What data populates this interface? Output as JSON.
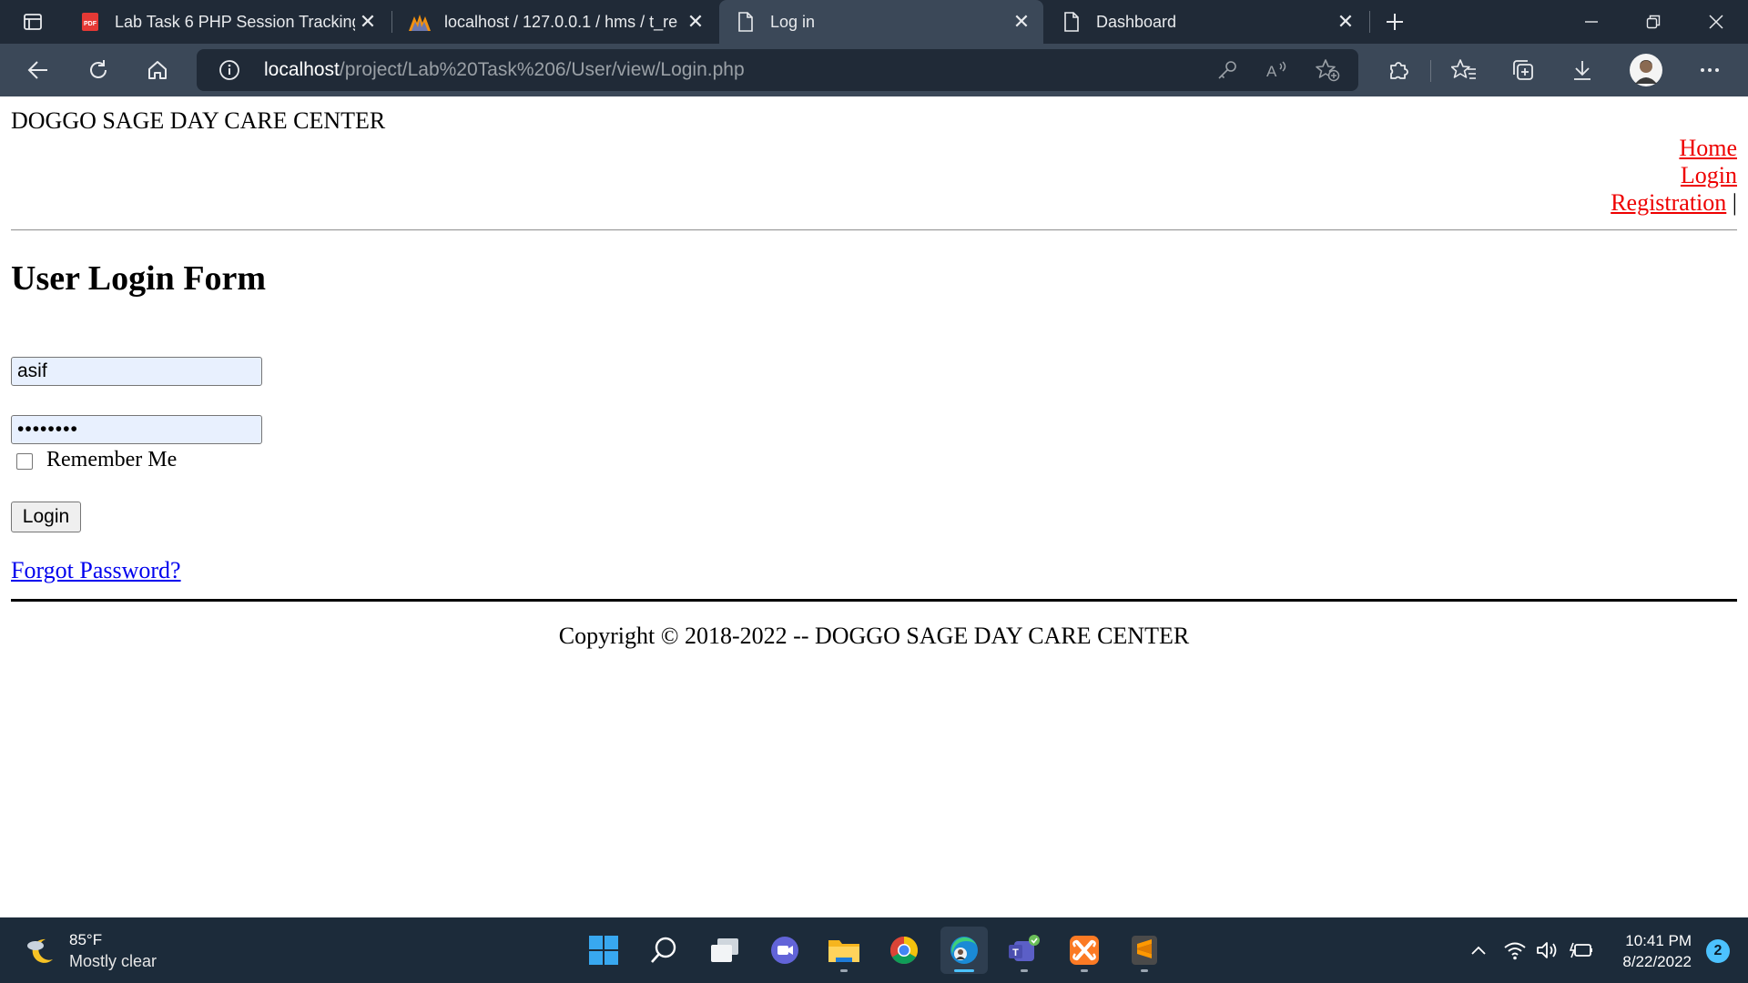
{
  "browser": {
    "tabs": [
      {
        "title": "Lab Task 6 PHP Session Tracking",
        "icon": "pdf-icon",
        "active": false
      },
      {
        "title": "localhost / 127.0.0.1 / hms / t_re",
        "icon": "phpmyadmin-icon",
        "active": false
      },
      {
        "title": "Log in",
        "icon": "page-icon",
        "active": true
      },
      {
        "title": "Dashboard",
        "icon": "page-icon",
        "active": false
      }
    ],
    "url": {
      "host": "localhost",
      "path": "/project/Lab%20Task%206/User/view/Login.php"
    }
  },
  "page": {
    "site_name": "DOGGO SAGE DAY CARE CENTER",
    "nav": {
      "home": "Home",
      "login": "Login",
      "registration": "Registration",
      "separator": "|"
    },
    "form": {
      "title": "User Login Form",
      "username_value": "asif",
      "password_mask": "••••••••",
      "remember_label": "Remember Me",
      "login_button": "Login",
      "forgot_link": "Forgot Password?"
    },
    "footer": {
      "copyright": "Copyright © 2018-2022 -- DOGGO SAGE DAY CARE CENTER"
    }
  },
  "taskbar": {
    "weather": {
      "temp": "85°F",
      "condition": "Mostly clear"
    },
    "apps": [
      "windows-start",
      "search",
      "task-view",
      "chat",
      "file-explorer",
      "chrome",
      "edge",
      "teams",
      "xampp",
      "sublime-text"
    ],
    "clock": {
      "time": "10:41 PM",
      "date": "8/22/2022"
    },
    "notifications": "2"
  },
  "colors": {
    "link": "#0000ee",
    "nav_link": "#ee0000",
    "input_autofill": "#e8f0fe",
    "tabbar": "#202a37",
    "toolbar": "#3b4858",
    "taskbar": "#1c2b3a",
    "accent": "#4cc2ff"
  }
}
